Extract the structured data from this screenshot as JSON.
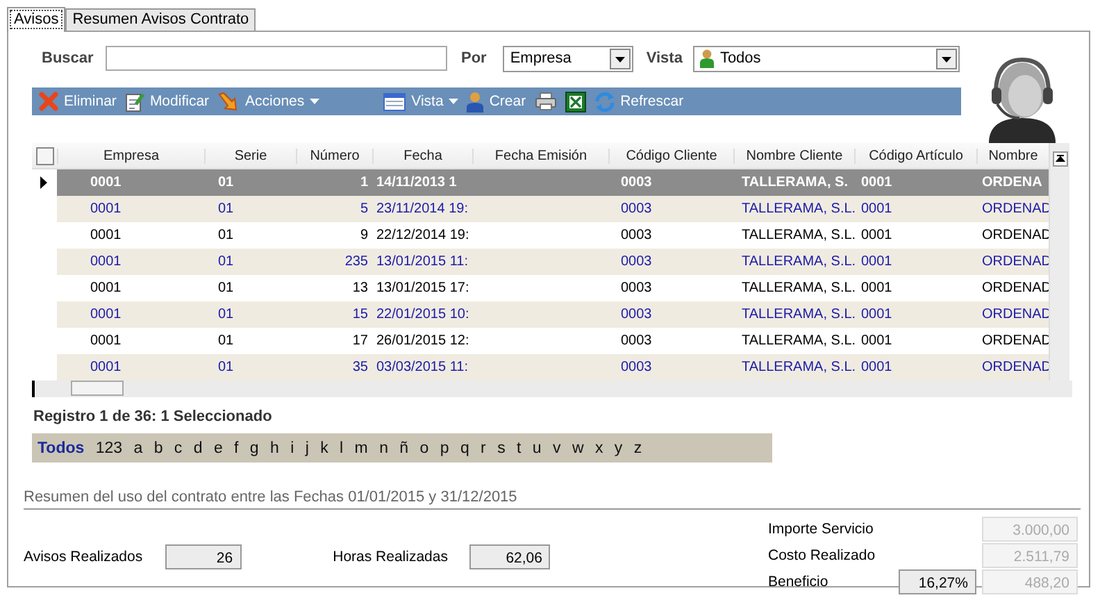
{
  "tabs": [
    {
      "label": "Avisos",
      "selected": true
    },
    {
      "label": "Resumen Avisos Contrato",
      "selected": false
    }
  ],
  "search": {
    "label": "Buscar",
    "por_label": "Por",
    "por_value": "Empresa",
    "vista_label": "Vista",
    "vista_value": "Todos"
  },
  "toolbar": [
    {
      "kind": "delete",
      "label": "Eliminar"
    },
    {
      "kind": "edit",
      "label": "Modificar"
    },
    {
      "kind": "actions",
      "label": "Acciones",
      "dropdown": true
    },
    {
      "kind": "view",
      "label": "Vista",
      "dropdown": true
    },
    {
      "kind": "create",
      "label": "Crear"
    },
    {
      "kind": "print"
    },
    {
      "kind": "excel"
    },
    {
      "kind": "refresh",
      "label": "Refrescar"
    }
  ],
  "table": {
    "select_all_checked": false,
    "columns": [
      "Empresa",
      "Serie",
      "Número",
      "Fecha",
      "Fecha Emisión",
      "Código Cliente",
      "Nombre Cliente",
      "Código Artículo",
      "Nombre"
    ],
    "rows": [
      {
        "selected": true,
        "empresa": "0001",
        "serie": "01",
        "numero": "1",
        "fecha": "14/11/2013 1",
        "codigo_cliente": "0003",
        "nombre_cliente": "TALLERAMA, S.",
        "codigo_articulo": "0001",
        "nombre": "ORDENA"
      },
      {
        "selected": false,
        "empresa": "0001",
        "serie": "01",
        "numero": "5",
        "fecha": "23/11/2014 19:",
        "codigo_cliente": "0003",
        "nombre_cliente": "TALLERAMA, S.L.",
        "codigo_articulo": "0001",
        "nombre": "ORDENAD"
      },
      {
        "selected": false,
        "empresa": "0001",
        "serie": "01",
        "numero": "9",
        "fecha": "22/12/2014 19:",
        "codigo_cliente": "0003",
        "nombre_cliente": "TALLERAMA, S.L.",
        "codigo_articulo": "0001",
        "nombre": "ORDENAD"
      },
      {
        "selected": false,
        "empresa": "0001",
        "serie": "01",
        "numero": "235",
        "fecha": "13/01/2015 11:",
        "codigo_cliente": "0003",
        "nombre_cliente": "TALLERAMA, S.L.",
        "codigo_articulo": "0001",
        "nombre": "ORDENAD"
      },
      {
        "selected": false,
        "empresa": "0001",
        "serie": "01",
        "numero": "13",
        "fecha": "13/01/2015 17:",
        "codigo_cliente": "0003",
        "nombre_cliente": "TALLERAMA, S.L.",
        "codigo_articulo": "0001",
        "nombre": "ORDENAD"
      },
      {
        "selected": false,
        "empresa": "0001",
        "serie": "01",
        "numero": "15",
        "fecha": "22/01/2015 10:",
        "codigo_cliente": "0003",
        "nombre_cliente": "TALLERAMA, S.L.",
        "codigo_articulo": "0001",
        "nombre": "ORDENAD"
      },
      {
        "selected": false,
        "empresa": "0001",
        "serie": "01",
        "numero": "17",
        "fecha": "26/01/2015 12:",
        "codigo_cliente": "0003",
        "nombre_cliente": "TALLERAMA, S.L.",
        "codigo_articulo": "0001",
        "nombre": "ORDENAD"
      },
      {
        "selected": false,
        "empresa": "0001",
        "serie": "01",
        "numero": "35",
        "fecha": "03/03/2015 11:",
        "codigo_cliente": "0003",
        "nombre_cliente": "TALLERAMA, S.L.",
        "codigo_articulo": "0001",
        "nombre": "ORDENAD"
      }
    ]
  },
  "record_status": "Registro 1 de 36: 1 Seleccionado",
  "alphabet": [
    {
      "label": "Todos",
      "selected": true
    },
    {
      "label": "123",
      "selected": false
    },
    {
      "label": "a",
      "selected": false
    },
    {
      "label": "b",
      "selected": false
    },
    {
      "label": "c",
      "selected": false
    },
    {
      "label": "d",
      "selected": false
    },
    {
      "label": "e",
      "selected": false
    },
    {
      "label": "f",
      "selected": false
    },
    {
      "label": "g",
      "selected": false
    },
    {
      "label": "h",
      "selected": false
    },
    {
      "label": "i",
      "selected": false
    },
    {
      "label": "j",
      "selected": false
    },
    {
      "label": "k",
      "selected": false
    },
    {
      "label": "l",
      "selected": false
    },
    {
      "label": "m",
      "selected": false
    },
    {
      "label": "n",
      "selected": false
    },
    {
      "label": "ñ",
      "selected": false
    },
    {
      "label": "o",
      "selected": false
    },
    {
      "label": "p",
      "selected": false
    },
    {
      "label": "q",
      "selected": false
    },
    {
      "label": "r",
      "selected": false
    },
    {
      "label": "s",
      "selected": false
    },
    {
      "label": "t",
      "selected": false
    },
    {
      "label": "u",
      "selected": false
    },
    {
      "label": "v",
      "selected": false
    },
    {
      "label": "w",
      "selected": false
    },
    {
      "label": "x",
      "selected": false
    },
    {
      "label": "y",
      "selected": false
    },
    {
      "label": "z",
      "selected": false
    }
  ],
  "summary": {
    "title": "Resumen del uso del contrato entre las Fechas 01/01/2015 y 31/12/2015",
    "avisos_label": "Avisos Realizados",
    "avisos_value": "26",
    "horas_label": "Horas Realizadas",
    "horas_value": "62,06",
    "right": [
      {
        "label": "Importe Servicio",
        "value": "3.000,00",
        "disabled": true
      },
      {
        "label": "Costo Realizado",
        "value": "2.511,79",
        "disabled": true
      },
      {
        "label": "Beneficio",
        "percent": "16,27%",
        "value": "488,20",
        "disabled": true
      }
    ]
  }
}
